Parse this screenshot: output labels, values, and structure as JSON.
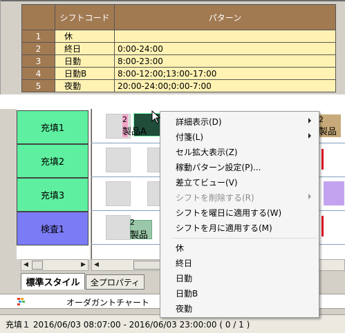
{
  "shift_table": {
    "headers": {
      "code": "シフトコード",
      "pattern": "パターン"
    },
    "rows": [
      {
        "num": "1",
        "code": "休",
        "pattern": ""
      },
      {
        "num": "2",
        "code": "終日",
        "pattern": "0:00-24:00"
      },
      {
        "num": "3",
        "code": "日勤",
        "pattern": "8:00-23:00"
      },
      {
        "num": "4",
        "code": "日勤B",
        "pattern": "8:00-12:00;13:00-17:00"
      },
      {
        "num": "5",
        "code": "夜勤",
        "pattern": "20:00-24:00;0:00-7:00"
      }
    ]
  },
  "gantt": {
    "rows": [
      {
        "label": "充填1",
        "kind": "fill"
      },
      {
        "label": "充填2",
        "kind": "fill"
      },
      {
        "label": "充填3",
        "kind": "fill"
      },
      {
        "label": "検査1",
        "kind": "inspect"
      }
    ],
    "bar_labels": {
      "row1_main": "製品A",
      "row1_main_num": "2",
      "row1_right": "製品",
      "row1_right_num": "2",
      "row4_main": "製品",
      "row4_main_num": "2"
    }
  },
  "tabs": [
    {
      "label": "標準スタイル",
      "active": true
    },
    {
      "label": "全プロパティ",
      "active": false
    }
  ],
  "order_bar": {
    "label": "オーダガントチャート"
  },
  "status_bar": {
    "text": "充填１ 2016/06/03 08:07:00 - 2016/06/03 23:00:00 ( 0 / 1 )"
  },
  "context_menu": {
    "items": [
      {
        "label": "詳細表示(D)",
        "submenu": true,
        "disabled": false
      },
      {
        "label": "付箋(L)",
        "submenu": true,
        "disabled": false
      },
      {
        "label": "セル拡大表示(Z)",
        "submenu": false,
        "disabled": false
      },
      {
        "label": "稼動パターン設定(P)...",
        "submenu": false,
        "disabled": false
      },
      {
        "label": "差立てビュー(V)",
        "submenu": false,
        "disabled": false
      },
      {
        "label": "シフトを削除する(R)",
        "submenu": true,
        "disabled": true
      },
      {
        "label": "シフトを曜日に適用する(W)",
        "submenu": false,
        "disabled": false
      },
      {
        "label": "シフトを月に適用する(M)",
        "submenu": false,
        "disabled": false
      }
    ],
    "shift_items": [
      "休",
      "終日",
      "日勤",
      "日勤B",
      "夜勤"
    ]
  }
}
